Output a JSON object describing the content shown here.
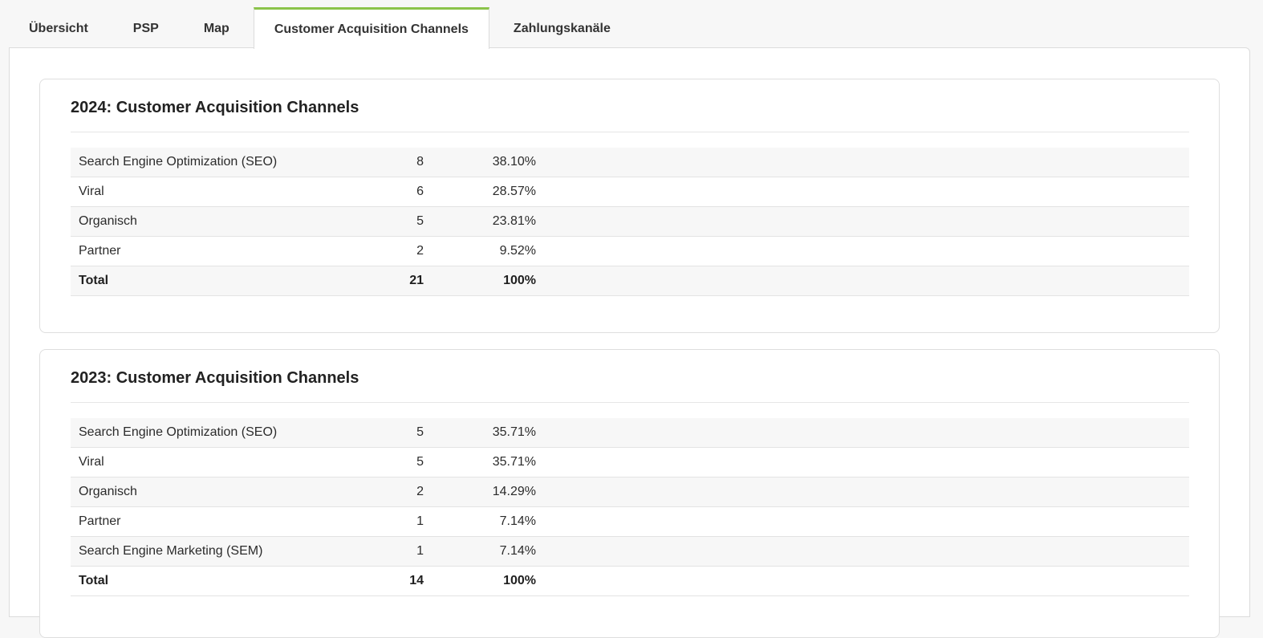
{
  "tabs": [
    {
      "label": "Übersicht",
      "active": false
    },
    {
      "label": "PSP",
      "active": false
    },
    {
      "label": "Map",
      "active": false
    },
    {
      "label": "Customer Acquisition Channels",
      "active": true
    },
    {
      "label": "Zahlungskanäle",
      "active": false
    }
  ],
  "colors": {
    "accent": "#8bc34a",
    "stripe": "#f7f7f7",
    "border": "#dedede"
  },
  "sections": [
    {
      "title": "2024: Customer Acquisition Channels",
      "rows": [
        {
          "name": "Search Engine Optimization (SEO)",
          "count": "8",
          "percent": "38.10%"
        },
        {
          "name": "Viral",
          "count": "6",
          "percent": "28.57%"
        },
        {
          "name": "Organisch",
          "count": "5",
          "percent": "23.81%"
        },
        {
          "name": "Partner",
          "count": "2",
          "percent": "9.52%"
        }
      ],
      "total": {
        "name": "Total",
        "count": "21",
        "percent": "100%"
      }
    },
    {
      "title": "2023: Customer Acquisition Channels",
      "rows": [
        {
          "name": "Search Engine Optimization (SEO)",
          "count": "5",
          "percent": "35.71%"
        },
        {
          "name": "Viral",
          "count": "5",
          "percent": "35.71%"
        },
        {
          "name": "Organisch",
          "count": "2",
          "percent": "14.29%"
        },
        {
          "name": "Partner",
          "count": "1",
          "percent": "7.14%"
        },
        {
          "name": "Search Engine Marketing (SEM)",
          "count": "1",
          "percent": "7.14%"
        }
      ],
      "total": {
        "name": "Total",
        "count": "14",
        "percent": "100%"
      }
    }
  ]
}
